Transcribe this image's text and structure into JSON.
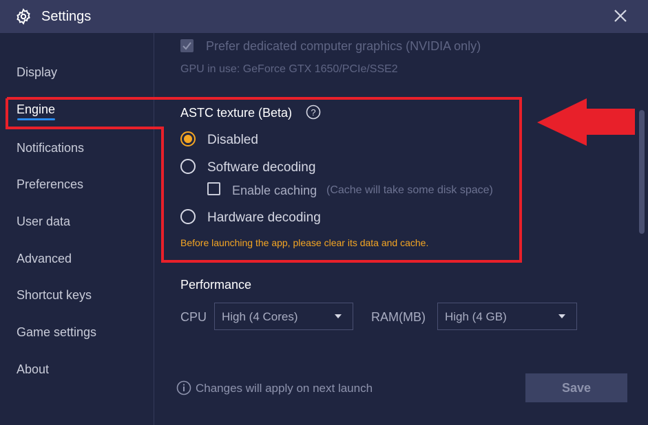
{
  "window": {
    "title": "Settings",
    "close_icon": "close-icon",
    "settings_icon": "gear-icon"
  },
  "sidebar": {
    "items": [
      {
        "label": "Display"
      },
      {
        "label": "Engine"
      },
      {
        "label": "Notifications"
      },
      {
        "label": "Preferences"
      },
      {
        "label": "User data"
      },
      {
        "label": "Advanced"
      },
      {
        "label": "Shortcut keys"
      },
      {
        "label": "Game settings"
      },
      {
        "label": "About"
      }
    ],
    "active": "Engine",
    "accent_color": "#2a8cf0"
  },
  "gpu": {
    "prefer_dedicated_label": "Prefer dedicated computer graphics (NVIDIA only)",
    "prefer_dedicated_checked": true,
    "gpu_in_use": "GPU in use: GeForce GTX 1650/PCIe/SSE2"
  },
  "astc": {
    "title": "ASTC texture (Beta)",
    "help_icon": "help-icon",
    "options": [
      {
        "label": "Disabled",
        "selected": true
      },
      {
        "label": "Software decoding",
        "selected": false
      },
      {
        "label": "Hardware decoding",
        "selected": false
      }
    ],
    "caching": {
      "label": "Enable caching",
      "note": "(Cache will take some disk space)",
      "checked": false
    },
    "warning": "Before launching the app, please clear its data and cache.",
    "warning_color": "#f5a623"
  },
  "performance": {
    "title": "Performance",
    "cpu_label": "CPU",
    "cpu_value": "High (4 Cores)",
    "ram_label": "RAM(MB)",
    "ram_value": "High (4 GB)"
  },
  "footer": {
    "info_icon": "info-icon",
    "note": "Changes will apply on next launch",
    "save_label": "Save"
  },
  "annotation": {
    "highlight_color": "#e8202a",
    "arrow_icon": "left-arrow-icon"
  }
}
